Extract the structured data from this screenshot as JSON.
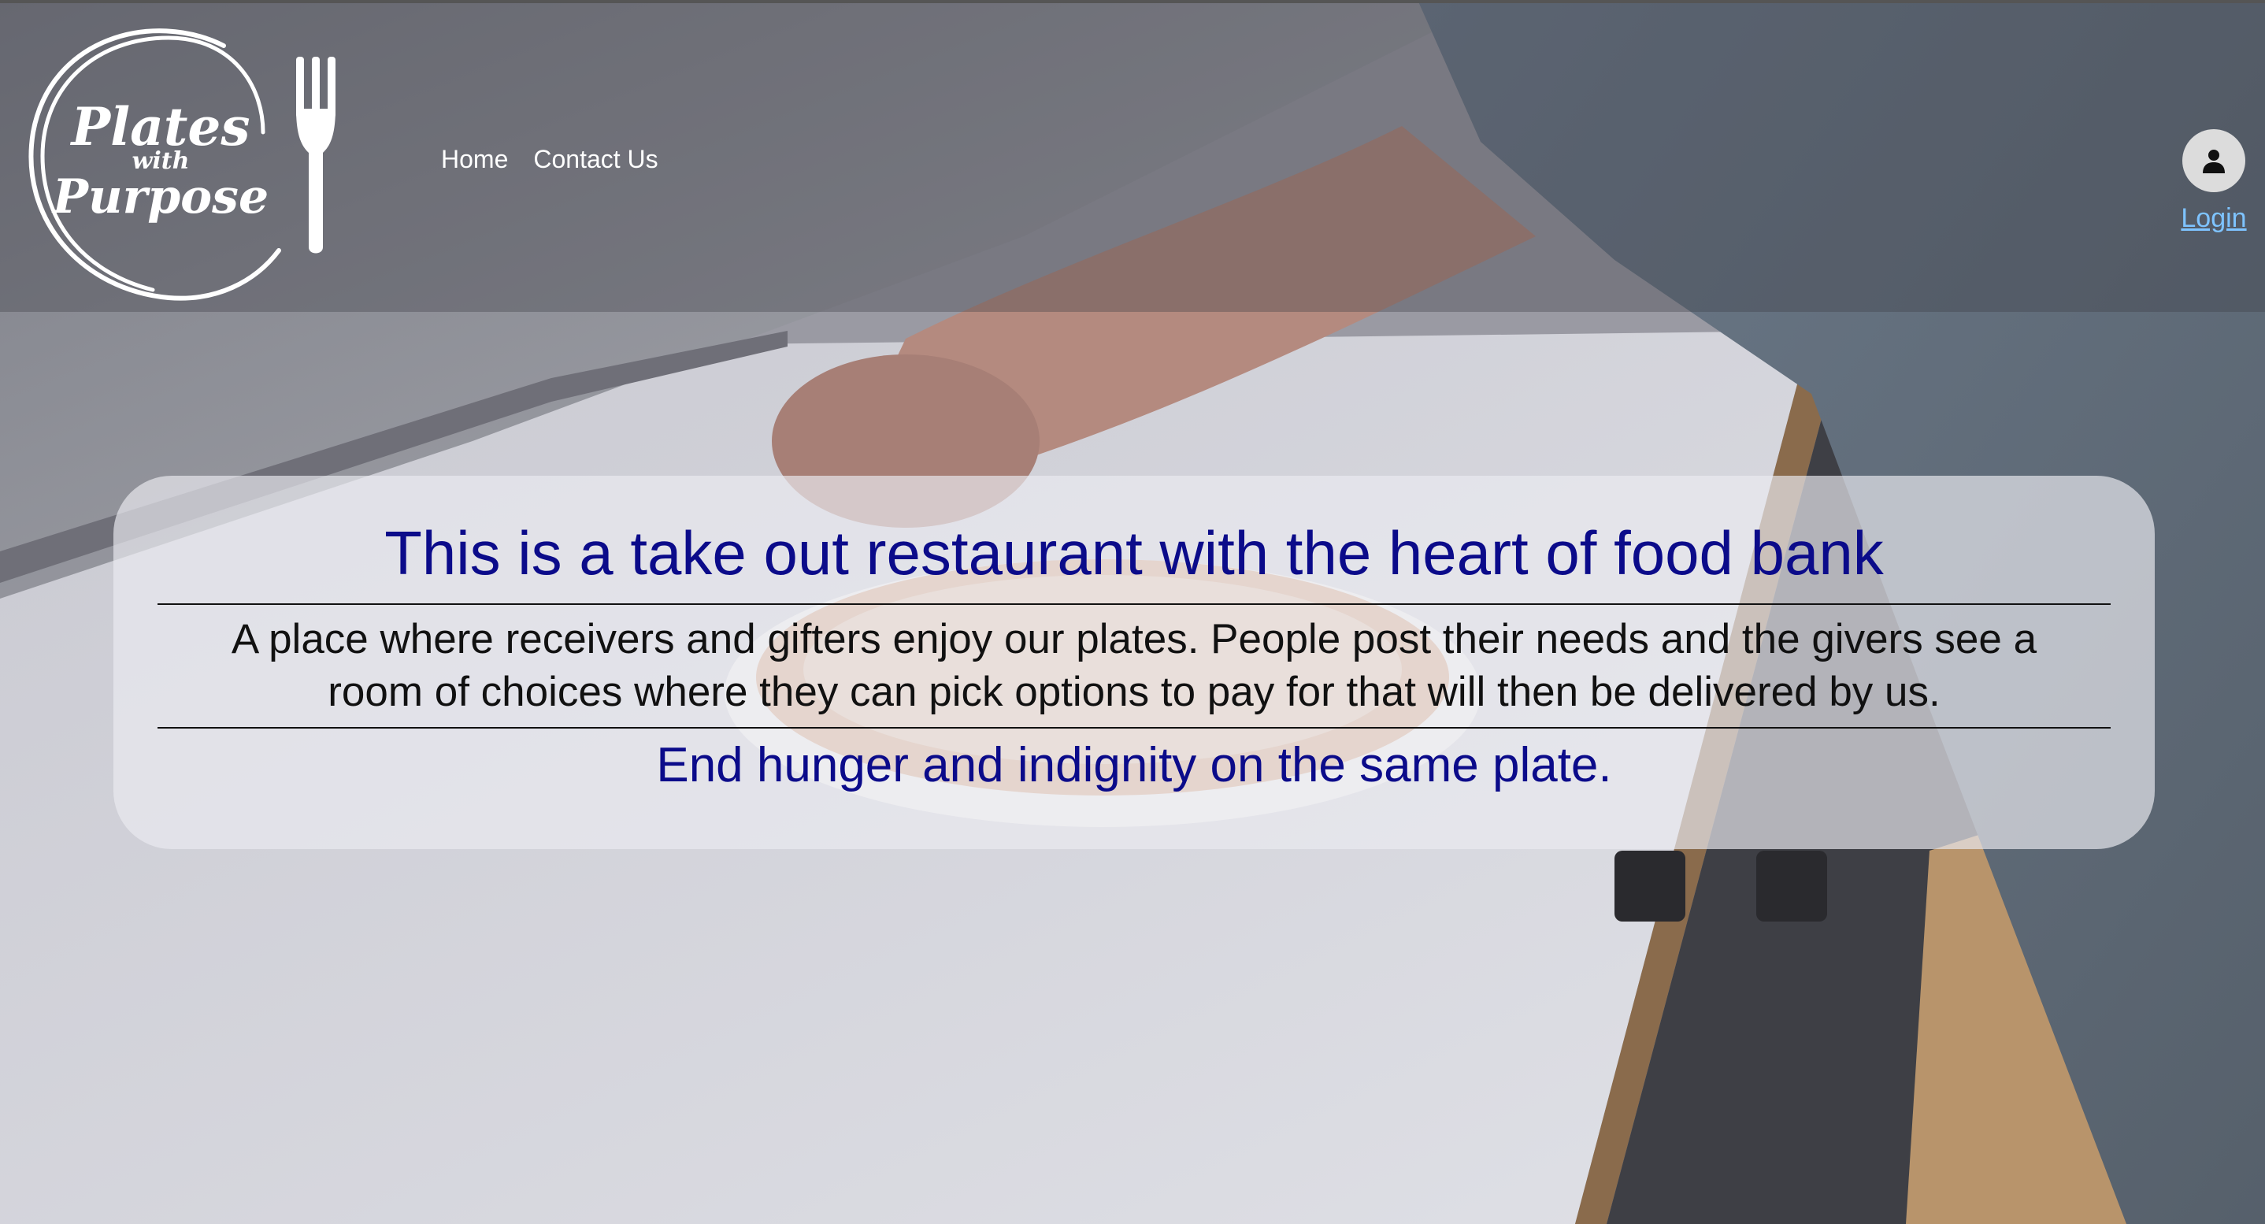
{
  "brand": {
    "logo_line1": "Plates",
    "logo_line2": "with",
    "logo_line3": "Purpose"
  },
  "nav": {
    "items": [
      {
        "label": "Home"
      },
      {
        "label": "Contact Us"
      }
    ]
  },
  "user": {
    "avatar_icon": "user-avatar-icon",
    "login_label": "Login"
  },
  "hero": {
    "title": "This is a take out restaurant with the heart of food bank",
    "description": "A place where receivers and gifters enjoy our plates. People post their needs and the givers see a room of choices where they can pick options to pay for that will then be delivered by us.",
    "tagline": "End hunger and indignity on the same plate."
  },
  "colors": {
    "title_color": "#0b0b8a",
    "login_link": "#7ec3ff",
    "card_background": "rgba(235,235,240,0.68)"
  }
}
